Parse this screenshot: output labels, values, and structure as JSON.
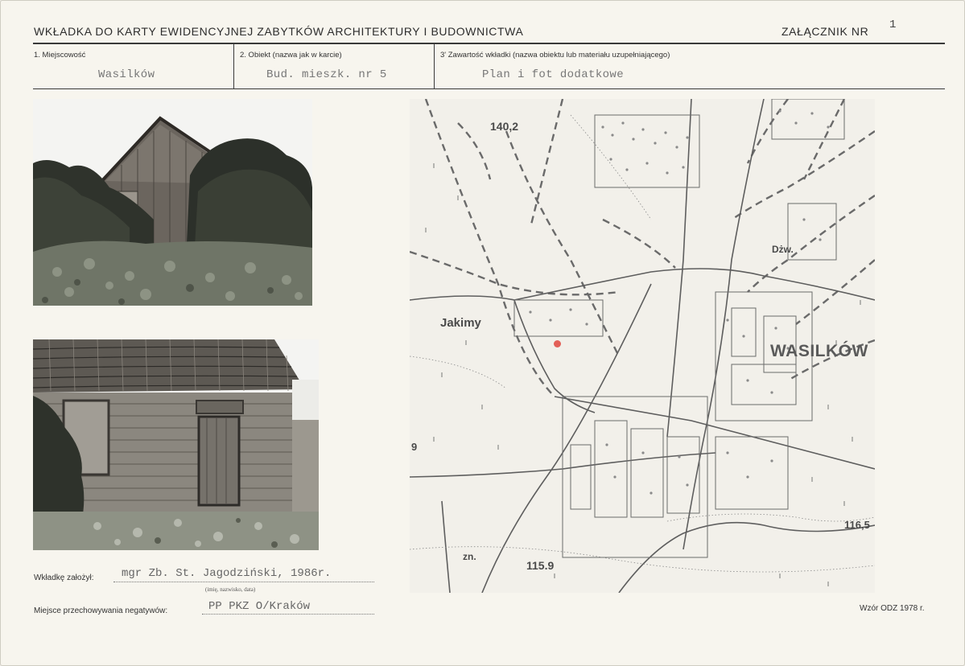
{
  "header": {
    "title": "WKŁADKA DO KARTY EWIDENCYJNEJ ZABYTKÓW ARCHITEKTURY I BUDOWNICTWA",
    "annex_label": "ZAŁĄCZNIK NR",
    "annex_number": "1"
  },
  "fields": {
    "locality_label": "1. Miejscowość",
    "locality_value": "Wasilków",
    "object_label": "2. Obiekt (nazwa jak w karcie)",
    "object_value": "Bud. mieszk. nr 5",
    "content_label": "3' Zawartość wkładki (nazwa obiektu lub materiału uzupełniającego)",
    "content_value": "Plan i fot dodatkowe"
  },
  "map": {
    "labels": {
      "elev1": "140,2",
      "jakimy": "Jakimy",
      "wasilkow": "WASILKÓW",
      "dzw": "Dżw.",
      "elev2": "116,5",
      "elev3": "115.9",
      "zn": "zn.",
      "nine": "9"
    },
    "marker_color": "#e0463e"
  },
  "footer": {
    "author_label": "Wkładkę założył:",
    "author_value": "mgr Zb. St. Jagodziński, 1986r.",
    "author_hint": "(imię, nazwisko, data)",
    "storage_label": "Miejsce przechowywania negatywów:",
    "storage_value": "PP PKZ O/Kraków",
    "template_note": "Wzór ODZ 1978 r."
  }
}
